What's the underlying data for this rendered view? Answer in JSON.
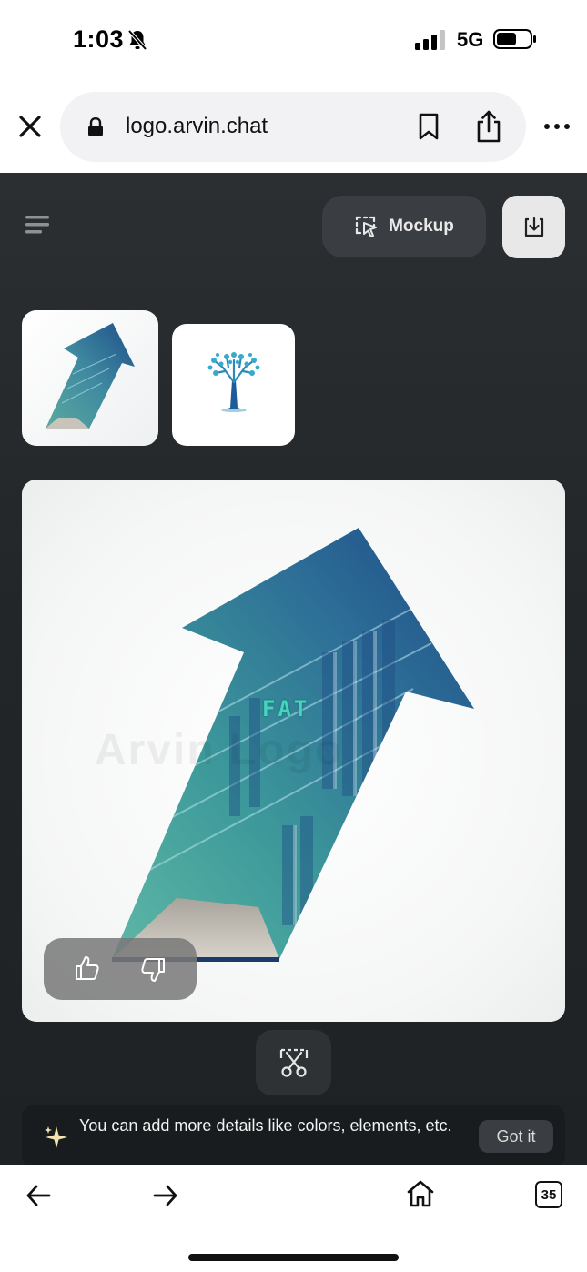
{
  "status_bar": {
    "time": "1:03",
    "network": "5G",
    "icons": [
      "bell-slash-icon",
      "signal-icon",
      "battery-icon"
    ]
  },
  "browser": {
    "url": "logo.arvin.chat",
    "icons": [
      "close-icon",
      "lock-icon",
      "bookmark-icon",
      "share-icon",
      "more-icon"
    ]
  },
  "app": {
    "menu_icon": "menu-icon",
    "mockup_label": "Mockup",
    "download_icon": "download-icon",
    "thumbnails": [
      {
        "name": "arrow-bookshelf-logo"
      },
      {
        "name": "tree-logo"
      }
    ],
    "main_image": {
      "watermark": "Arvin Logo",
      "logo_text": "FAT"
    },
    "feedback": {
      "icons": [
        "thumbs-up-icon",
        "thumbs-down-icon"
      ]
    },
    "tip": {
      "text": "You can add more details like colors, elements, etc.",
      "button_label": "Got it"
    }
  },
  "bottom_nav": {
    "tab_count": "35",
    "icons": [
      "back-arrow-icon",
      "forward-arrow-icon",
      "home-icon",
      "tabs-icon"
    ]
  },
  "colors": {
    "app_background": "#25292b",
    "accent_teal": "#45d4bd",
    "pill_background": "#3a3d41"
  }
}
